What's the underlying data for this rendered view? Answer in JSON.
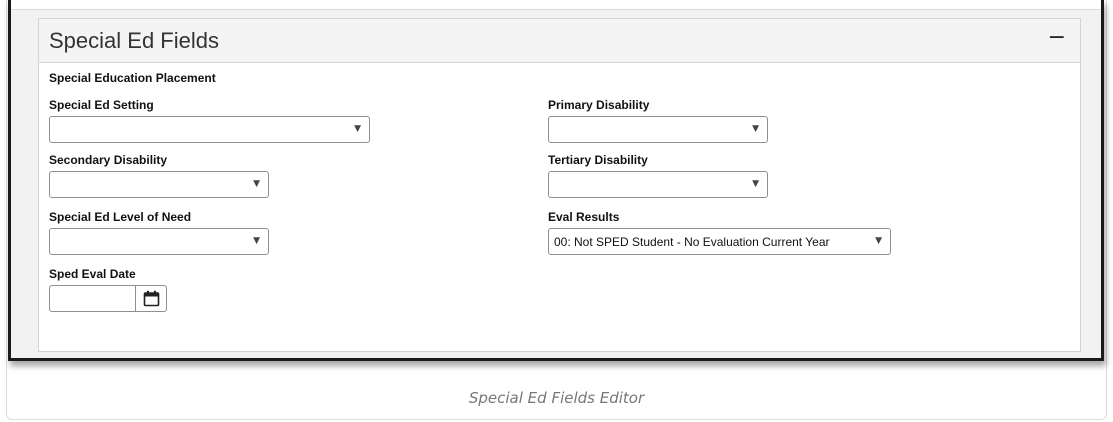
{
  "panel": {
    "title": "Special Ed Fields",
    "collapse_symbol": "−",
    "collapse_icon": "minus-icon"
  },
  "section": {
    "heading": "Special Education Placement"
  },
  "fields": {
    "special_ed_setting": {
      "label": "Special Ed Setting",
      "value": ""
    },
    "primary_disability": {
      "label": "Primary Disability",
      "value": ""
    },
    "secondary_disability": {
      "label": "Secondary Disability",
      "value": ""
    },
    "tertiary_disability": {
      "label": "Tertiary Disability",
      "value": ""
    },
    "special_ed_level_of_need": {
      "label": "Special Ed Level of Need",
      "value": ""
    },
    "eval_results": {
      "label": "Eval Results",
      "value": "00: Not SPED Student - No Evaluation Current Year"
    },
    "sped_eval_date": {
      "label": "Sped Eval Date",
      "value": "",
      "icon": "calendar-icon"
    }
  },
  "dropdown_arrow": "▼",
  "caption": "Special Ed Fields Editor"
}
